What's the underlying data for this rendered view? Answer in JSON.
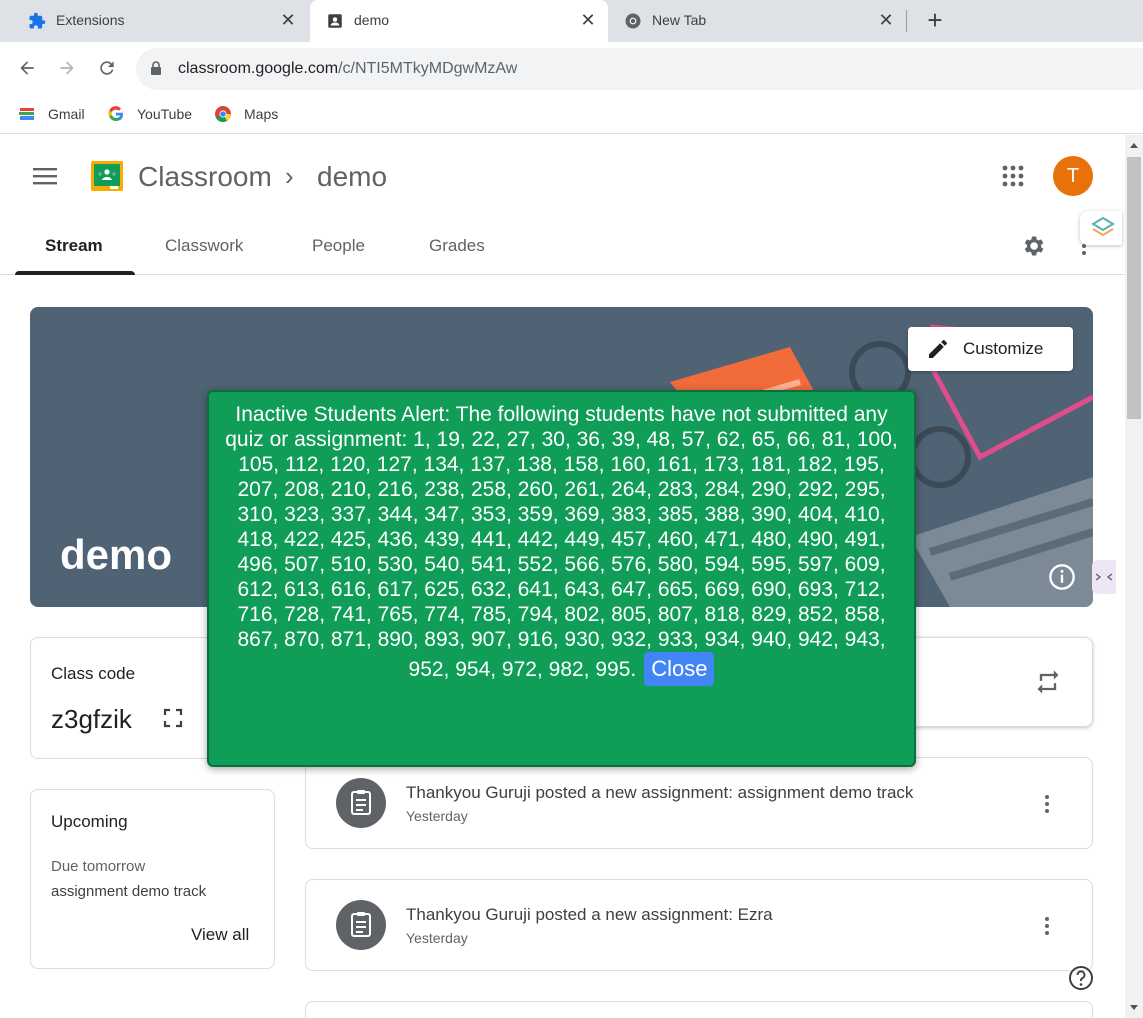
{
  "browser": {
    "tabs": [
      {
        "title": "Extensions",
        "icon": "puzzle-icon",
        "active": false
      },
      {
        "title": "demo",
        "icon": "classroom-icon",
        "active": true
      },
      {
        "title": "New Tab",
        "icon": "chrome-icon",
        "active": false
      }
    ],
    "url": {
      "host": "classroom.google.com",
      "path": "/c/NTI5MTkyMDgwMzAw"
    },
    "bookmarks": [
      {
        "label": "Gmail",
        "icon": "books-icon"
      },
      {
        "label": "YouTube",
        "icon": "google-g-icon"
      },
      {
        "label": "Maps",
        "icon": "chrome-icon"
      }
    ]
  },
  "app": {
    "title": "Classroom",
    "class_name": "demo",
    "avatar_initial": "T",
    "nav_tabs": [
      {
        "label": "Stream",
        "active": true
      },
      {
        "label": "Classwork",
        "active": false
      },
      {
        "label": "People",
        "active": false
      },
      {
        "label": "Grades",
        "active": false
      }
    ]
  },
  "banner": {
    "title": "demo",
    "customize_label": "Customize"
  },
  "class_code": {
    "label": "Class code",
    "value": "z3gfzik"
  },
  "upcoming": {
    "title": "Upcoming",
    "due_label": "Due tomorrow",
    "item": "assignment demo track",
    "view_all": "View all"
  },
  "posts": [
    {
      "text": "Thankyou Guruji posted a new assignment: assignment demo track",
      "date": "Yesterday"
    },
    {
      "text": "Thankyou Guruji posted a new assignment: Ezra",
      "date": "Yesterday"
    }
  ],
  "alert": {
    "message": "Inactive Students Alert: The following students have not submitted any quiz or assignment: 1, 19, 22, 27, 30, 36, 39, 48, 57, 62, 65, 66, 81, 100, 105, 112, 120, 127, 134, 137, 138, 158, 160, 161, 173, 181, 182, 195, 207, 208, 210, 216, 238, 258, 260, 261, 264, 283, 284, 290, 292, 295, 310, 323, 337, 344, 347, 353, 359, 369, 383, 385, 388, 390, 404, 410, 418, 422, 425, 436, 439, 441, 442, 449, 457, 460, 471, 480, 490, 491, 496, 507, 510, 530, 540, 541, 552, 566, 576, 580, 594, 595, 597, 609, 612, 613, 616, 617, 625, 632, 641, 643, 647, 665, 669, 690, 693, 712, 716, 728, 741, 765, 774, 785, 794, 802, 805, 807, 818, 829, 852, 858, 867, 870, 871, 890, 893, 907, 916, 930, 932, 933, 934, 940, 942, 943, 952, 954, 972, 982, 995.",
    "close_label": "Close"
  },
  "colors": {
    "alert_bg": "#0f9d58",
    "close_button": "#4285f4",
    "avatar": "#e8710a",
    "banner": "#4f6375"
  }
}
